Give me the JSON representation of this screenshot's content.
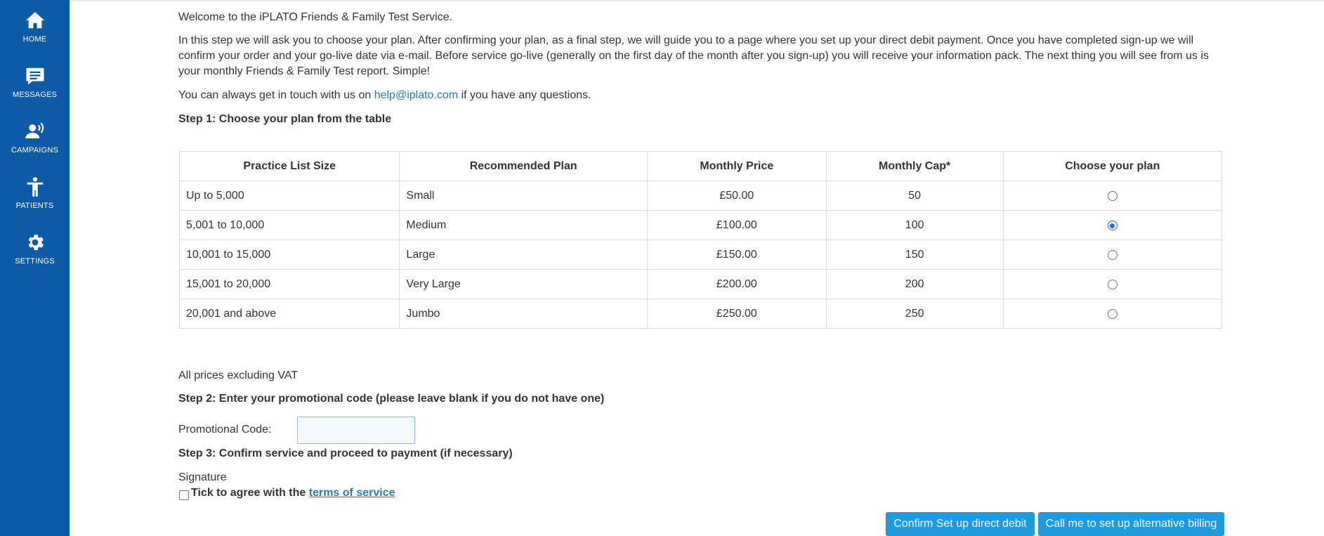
{
  "sidebar": {
    "color": "#0d5ba6",
    "items": [
      {
        "label": "HOME",
        "icon": "home-icon"
      },
      {
        "label": "MESSAGES",
        "icon": "message-icon"
      },
      {
        "label": "CAMPAIGNS",
        "icon": "campaign-icon"
      },
      {
        "label": "PATIENTS",
        "icon": "person-icon"
      },
      {
        "label": "SETTINGS",
        "icon": "gear-icon"
      }
    ]
  },
  "intro": {
    "welcome": "Welcome to the iPLATO Friends & Family Test Service.",
    "step_description": "In this step we will ask you to choose your plan. After confirming your plan, as a final step, we will guide you to a page where you set up your direct debit payment. Once you have completed sign-up we will confirm your order and your go-live date via e-mail. Before service go-live (generally on the first day of the month after you sign-up) you will receive your information pack. The next thing you will see from us is your monthly Friends & Family Test report. Simple!",
    "contact_prefix": "You can always get in touch with us on ",
    "contact_email": "help@iplato.com",
    "contact_suffix": " if you have any questions."
  },
  "step1": {
    "heading": "Step 1: Choose your plan from the table",
    "columns": [
      "Practice List Size",
      "Recommended Plan",
      "Monthly Price",
      "Monthly Cap*",
      "Choose your plan"
    ],
    "rows": [
      {
        "size": "Up to 5,000",
        "plan": "Small",
        "price": "£50.00",
        "cap": "50",
        "selected": false
      },
      {
        "size": "5,001 to 10,000",
        "plan": "Medium",
        "price": "£100.00",
        "cap": "100",
        "selected": true
      },
      {
        "size": "10,001 to 15,000",
        "plan": "Large",
        "price": "£150.00",
        "cap": "150",
        "selected": false
      },
      {
        "size": "15,001 to 20,000",
        "plan": "Very Large",
        "price": "£200.00",
        "cap": "200",
        "selected": false
      },
      {
        "size": "20,001 and above",
        "plan": "Jumbo",
        "price": "£250.00",
        "cap": "250",
        "selected": false
      }
    ],
    "vat_note": "All prices excluding VAT"
  },
  "step2": {
    "heading": "Step 2: Enter your promotional code (please leave blank if you do not have one)",
    "promo_label": "Promotional Code:",
    "promo_value": ""
  },
  "step3": {
    "heading": "Step 3: Confirm service and proceed to payment (if necessary)",
    "signature_label": "Signature",
    "agree_prefix": "Tick to agree with the ",
    "agree_link": "terms of service",
    "agree_checked": false
  },
  "buttons": {
    "confirm_label": "Confirm Set up direct debit",
    "call_label": "Call me to set up alternative billing",
    "color": "#1e9ae0"
  },
  "colors": {
    "link": "#2a7ab5",
    "text": "#333333"
  }
}
